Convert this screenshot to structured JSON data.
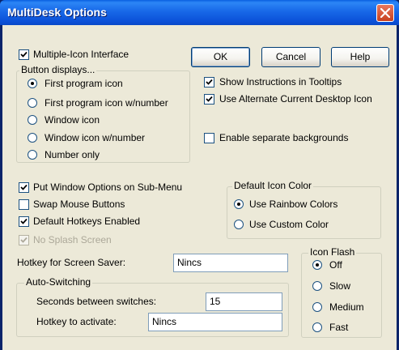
{
  "window": {
    "title": "MultiDesk Options"
  },
  "buttons": {
    "ok": "OK",
    "cancel": "Cancel",
    "help": "Help"
  },
  "multiple_icon": {
    "label": "Multiple-Icon Interface",
    "checked": true
  },
  "button_displays": {
    "title": "Button displays...",
    "options": [
      {
        "label": "First program icon",
        "selected": true
      },
      {
        "label": "First program icon w/number",
        "selected": false
      },
      {
        "label": "Window icon",
        "selected": false
      },
      {
        "label": "Window icon w/number",
        "selected": false
      },
      {
        "label": "Number only",
        "selected": false
      }
    ]
  },
  "right_options": [
    {
      "label": "Show Instructions in Tooltips",
      "checked": true
    },
    {
      "label": "Use Alternate Current Desktop Icon",
      "checked": true
    },
    {
      "label": "Enable separate backgrounds",
      "checked": false
    }
  ],
  "left_options": [
    {
      "label": "Put Window Options on Sub-Menu",
      "checked": true
    },
    {
      "label": "Swap Mouse Buttons",
      "checked": false
    },
    {
      "label": "Default Hotkeys Enabled",
      "checked": true
    },
    {
      "label": "No Splash Screen",
      "checked": true,
      "disabled": true
    }
  ],
  "default_icon_color": {
    "title": "Default Icon Color",
    "options": [
      {
        "label": "Use Rainbow Colors",
        "selected": true
      },
      {
        "label": "Use Custom Color",
        "selected": false
      }
    ]
  },
  "screen_saver": {
    "label": "Hotkey for Screen Saver:",
    "value": "Nincs"
  },
  "auto_switching": {
    "title": "Auto-Switching",
    "seconds_label": "Seconds between switches:",
    "seconds_value": "15",
    "hotkey_label": "Hotkey to activate:",
    "hotkey_value": "Nincs"
  },
  "icon_flash": {
    "title": "Icon Flash",
    "options": [
      {
        "label": "Off",
        "selected": true
      },
      {
        "label": "Slow",
        "selected": false
      },
      {
        "label": "Medium",
        "selected": false
      },
      {
        "label": "Fast",
        "selected": false
      }
    ]
  },
  "colors": {
    "titlebar": "#0B51D8",
    "background": "#ECE9D8",
    "close_button": "#C8401E"
  }
}
